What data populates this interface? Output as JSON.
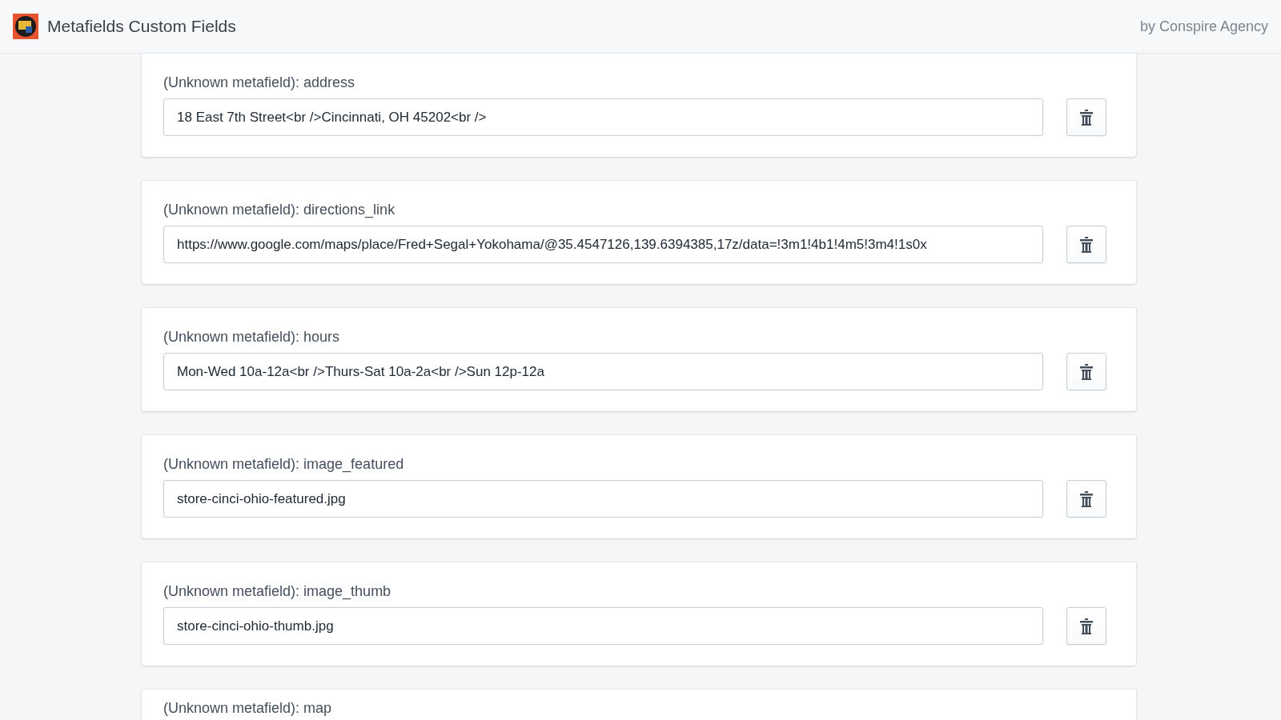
{
  "header": {
    "title": "Metafields Custom Fields",
    "byline": "by Conspire Agency"
  },
  "fields": [
    {
      "label": "(Unknown metafield): address",
      "value": "18 East 7th Street<br />Cincinnati, OH 45202<br />"
    },
    {
      "label": "(Unknown metafield): directions_link",
      "value": "https://www.google.com/maps/place/Fred+Segal+Yokohama/@35.4547126,139.6394385,17z/data=!3m1!4b1!4m5!3m4!1s0x"
    },
    {
      "label": "(Unknown metafield): hours",
      "value": "Mon-Wed 10a-12a<br />Thurs-Sat 10a-2a<br />Sun 12p-12a"
    },
    {
      "label": "(Unknown metafield): image_featured",
      "value": "store-cinci-ohio-featured.jpg"
    },
    {
      "label": "(Unknown metafield): image_thumb",
      "value": "store-cinci-ohio-thumb.jpg"
    },
    {
      "label": "(Unknown metafield): map"
    }
  ]
}
